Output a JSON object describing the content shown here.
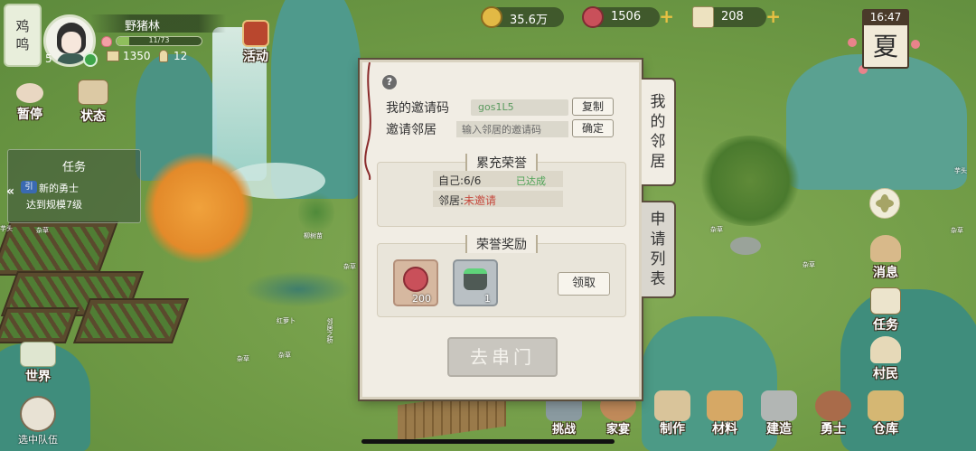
{
  "player": {
    "badge_chars": [
      "鸡",
      "鸣"
    ],
    "level": "5",
    "name": "野猪林",
    "exp_text": "11/73",
    "exp_fraction": 0.15,
    "houses": "1350",
    "people": "12"
  },
  "top_left_buttons": {
    "event": "活动",
    "pause": "暂停",
    "status": "状态"
  },
  "task_panel": {
    "title": "任务",
    "tag": "引",
    "task_name": "新的勇士",
    "task_desc": "达到规模7级"
  },
  "left_bottom": {
    "world": "世界",
    "team": "选中队伍"
  },
  "resources": {
    "coins": "35.6万",
    "meat": "1506",
    "tickets": "208",
    "plus": "+"
  },
  "clock": {
    "time": "16:47",
    "season": "夏"
  },
  "right_buttons": {
    "message": "消息",
    "task": "任务",
    "villager": "村民"
  },
  "bottom_bar": {
    "challenge": "挑战",
    "feast": "家宴",
    "craft": "制作",
    "material": "材料",
    "build": "建造",
    "warrior": "勇士",
    "warehouse": "仓库"
  },
  "dialog": {
    "help": "?",
    "my_code_label": "我的邀请码",
    "my_code_value": "gos1L5",
    "copy_btn": "复制",
    "invite_label": "邀请邻居",
    "invite_placeholder": "输入邻居的邀请码",
    "confirm_btn": "确定",
    "honor_title": "累充荣誉",
    "self_progress": "自己:6/6",
    "self_status": "已达成",
    "neighbor_progress": "邻居:",
    "neighbor_status": "未邀请",
    "rewards_title": "荣誉奖励",
    "reward1_qty": "200",
    "reward2_qty": "1",
    "claim_btn": "领取",
    "visit_btn": "去串门"
  },
  "side_tabs": {
    "my_neighbors": [
      "我",
      "的",
      "邻",
      "居"
    ],
    "apply_list": [
      "申",
      "请",
      "列",
      "表"
    ]
  },
  "map_labels": {
    "l1": "芋头",
    "l2": "杂草",
    "l3": "柳树苗",
    "l4": "杂草",
    "l5": "红萝卜",
    "l6": "杂草",
    "l7": "邻居之桥",
    "l8": "杂草",
    "l9": "杂草",
    "l10": "杂草",
    "l11": "杂草",
    "l12": "芋头"
  }
}
